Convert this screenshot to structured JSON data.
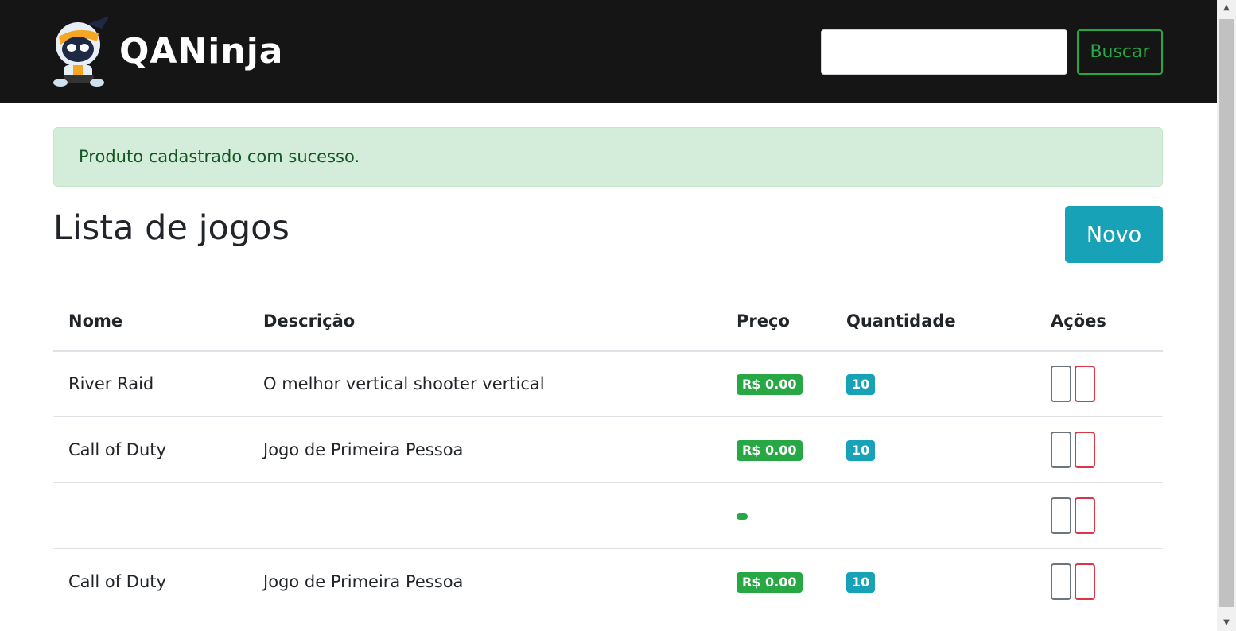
{
  "navbar": {
    "brand": "QANinja",
    "search_value": "",
    "search_button": "Buscar"
  },
  "alert": "Produto cadastrado com sucesso.",
  "title": "Lista de jogos",
  "new_button": "Novo",
  "table": {
    "headers": [
      "Nome",
      "Descrição",
      "Preço",
      "Quantidade",
      "Ações"
    ],
    "rows": [
      {
        "name": "River Raid",
        "description": "O melhor vertical shooter vertical",
        "price": "R$ 0.00",
        "quantity": "10"
      },
      {
        "name": "Call of Duty",
        "description": "Jogo de Primeira Pessoa",
        "price": "R$ 0.00",
        "quantity": "10"
      },
      {
        "name": "",
        "description": "",
        "price": "",
        "quantity": ""
      },
      {
        "name": "Call of Duty",
        "description": "Jogo de Primeira Pessoa",
        "price": "R$ 0.00",
        "quantity": "10"
      }
    ]
  },
  "colors": {
    "navbar": "#151515",
    "success": "#28a745",
    "info": "#17a2b8",
    "danger": "#dc3545",
    "secondary": "#6c757d"
  }
}
